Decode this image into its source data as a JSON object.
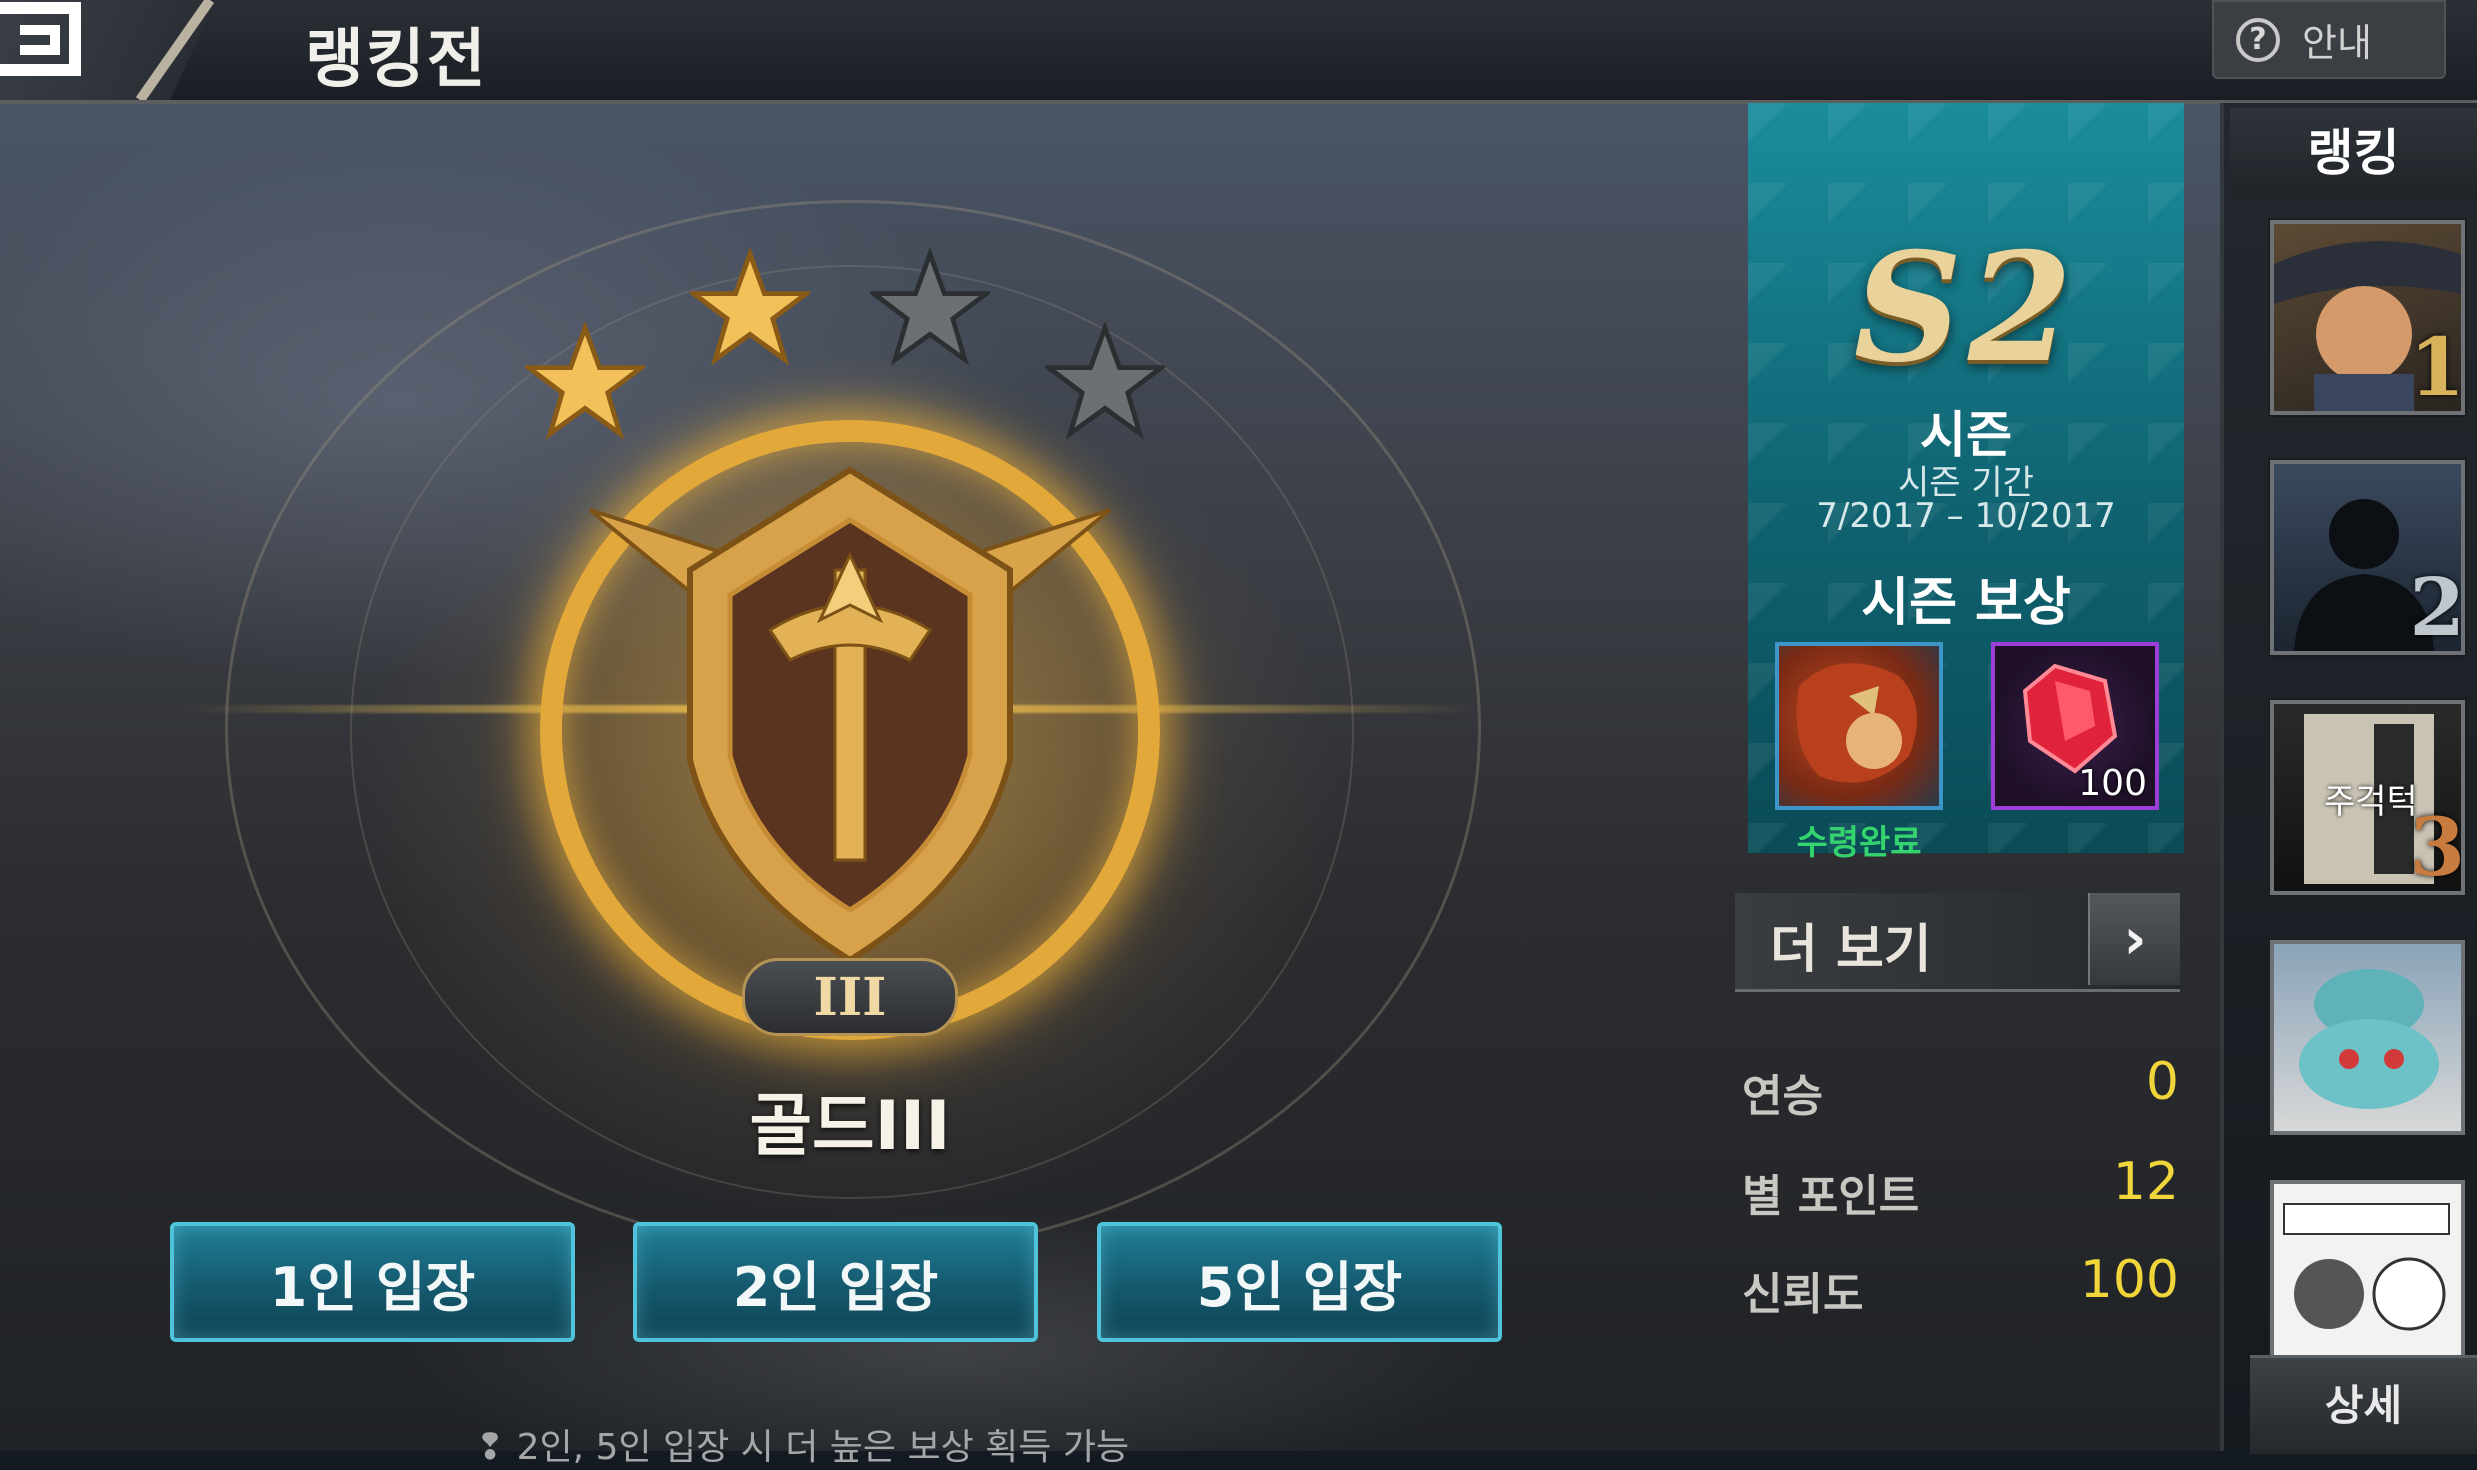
{
  "header": {
    "title": "랭킹전",
    "help_label": "안내",
    "help_icon": "question-circle-icon"
  },
  "rank": {
    "name": "골드III",
    "tier": "III",
    "stars_filled": 2,
    "stars_total": 4
  },
  "entry_buttons": [
    {
      "label": "1인 입장"
    },
    {
      "label": "2인 입장"
    },
    {
      "label": "5인 입장"
    }
  ],
  "hint": "2인, 5인 입장 시 더 높은 보상 획득 가능",
  "season": {
    "code": "S2",
    "label": "시즌",
    "period_label": "시즌 기간",
    "period": "7/2017 – 10/2017",
    "reward_title": "시즌 보상",
    "rewards": [
      {
        "type": "hero-skin",
        "status": "수령완료"
      },
      {
        "type": "ruby-gem",
        "count": "100"
      }
    ],
    "more_label": "더 보기"
  },
  "stats": [
    {
      "label": "연승",
      "value": "0"
    },
    {
      "label": "별 포인트",
      "value": "12"
    },
    {
      "label": "신뢰도",
      "value": "100"
    }
  ],
  "ranking": {
    "title": "랭킹",
    "entries": [
      {
        "rank": "1",
        "color": "#d8b25a"
      },
      {
        "rank": "2",
        "color": "#bfc6cc"
      },
      {
        "rank": "3",
        "color": "#c77b3e",
        "avatar_text": "주걱턱"
      },
      {
        "rank": "",
        "color": ""
      },
      {
        "rank": "",
        "color": ""
      }
    ],
    "detail_label": "상세"
  },
  "colors": {
    "accent_teal": "#1f7e96",
    "gold": "#e2a83a",
    "stat_value": "#f0d63a",
    "claimed_green": "#34d36e"
  }
}
